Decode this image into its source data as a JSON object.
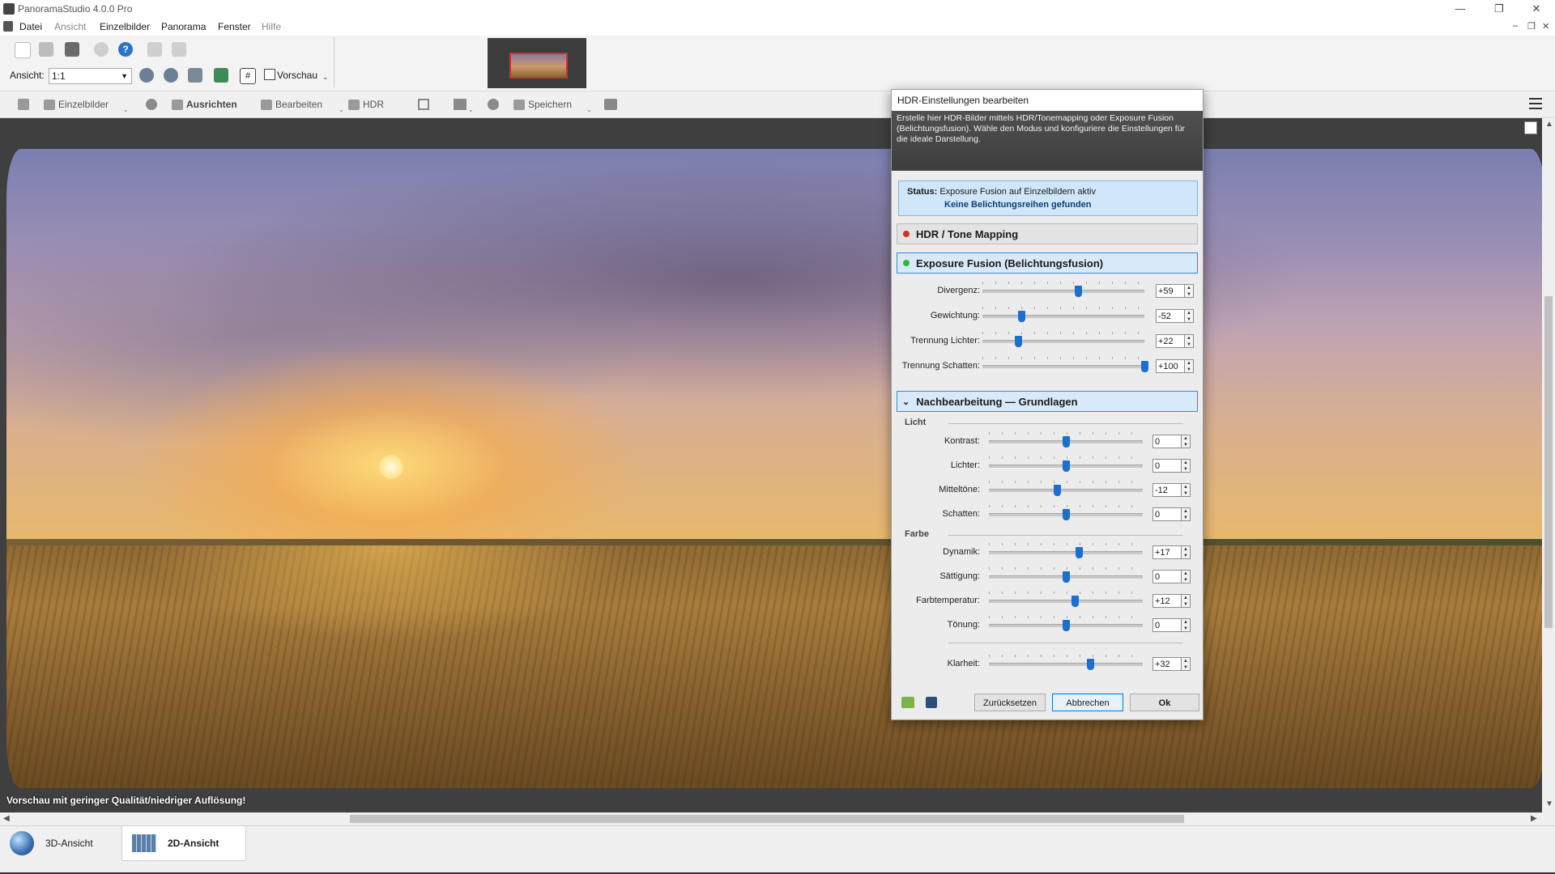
{
  "window": {
    "title": "PanoramaStudio 4.0.0 Pro",
    "minimize": "—",
    "maximize": "❐",
    "close": "✕"
  },
  "menu": [
    "Datei",
    "Ansicht",
    "Einzelbilder",
    "Panorama",
    "Fenster",
    "Hilfe"
  ],
  "toolbar": {
    "view_label": "Ansicht:",
    "view_value": "1:1",
    "preview_label": "Vorschau"
  },
  "toolbar2": {
    "items": [
      "Einzelbilder",
      "Ausrichten",
      "Bearbeiten",
      "HDR",
      "Speichern"
    ]
  },
  "canvas": {
    "note": "Vorschau mit geringer Qualität/niedriger Auflösung!"
  },
  "bottom_tabs": [
    {
      "label": "3D-Ansicht"
    },
    {
      "label": "2D-Ansicht",
      "active": true
    }
  ],
  "dialog": {
    "title": "HDR-Einstellungen bearbeiten",
    "description": "Erstelle hier HDR-Bilder mittels HDR/Tonemapping oder Exposure Fusion (Belichtungsfusion). Wähle den Modus und konfiguriere die Einstellungen für die ideale Darstellung.",
    "status_label": "Status:",
    "status_text": "Exposure Fusion auf Einzelbildern aktiv",
    "status_sub": "Keine Belichtungsreihen gefunden",
    "sections": {
      "hdr": {
        "label": "HDR / Tone Mapping",
        "color": "#d0312d"
      },
      "fusion": {
        "label": "Exposure Fusion (Belichtungsfusion)",
        "color": "#3cb43c"
      },
      "post": {
        "label": "Nachbearbeitung — Grundlagen",
        "toggle": "⌄"
      }
    },
    "fusion_sliders": [
      {
        "label": "Divergenz:",
        "value": "+59",
        "level": 0.59
      },
      {
        "label": "Gewichtung:",
        "value": "-52",
        "level": 0.24
      },
      {
        "label": "Trennung Lichter:",
        "value": "+22",
        "level": 0.22
      },
      {
        "label": "Trennung Schatten:",
        "value": "+100",
        "level": 1.0
      }
    ],
    "groups": {
      "licht": "Licht",
      "farbe": "Farbe"
    },
    "licht_sliders": [
      {
        "label": "Kontrast:",
        "value": "0",
        "level": 0.5
      },
      {
        "label": "Lichter:",
        "value": "0",
        "level": 0.5
      },
      {
        "label": "Mitteltöne:",
        "value": "-12",
        "level": 0.44
      },
      {
        "label": "Schatten:",
        "value": "0",
        "level": 0.5
      }
    ],
    "farbe_sliders": [
      {
        "label": "Dynamik:",
        "value": "+17",
        "level": 0.585
      },
      {
        "label": "Sättigung:",
        "value": "0",
        "level": 0.5
      },
      {
        "label": "Farbtemperatur:",
        "value": "+12",
        "level": 0.56
      },
      {
        "label": "Tönung:",
        "value": "0",
        "level": 0.5
      }
    ],
    "klarheit": {
      "label": "Klarheit:",
      "value": "+32",
      "level": 0.66
    },
    "buttons": {
      "reset": "Zurücksetzen",
      "cancel": "Abbrechen",
      "ok": "Ok"
    }
  }
}
